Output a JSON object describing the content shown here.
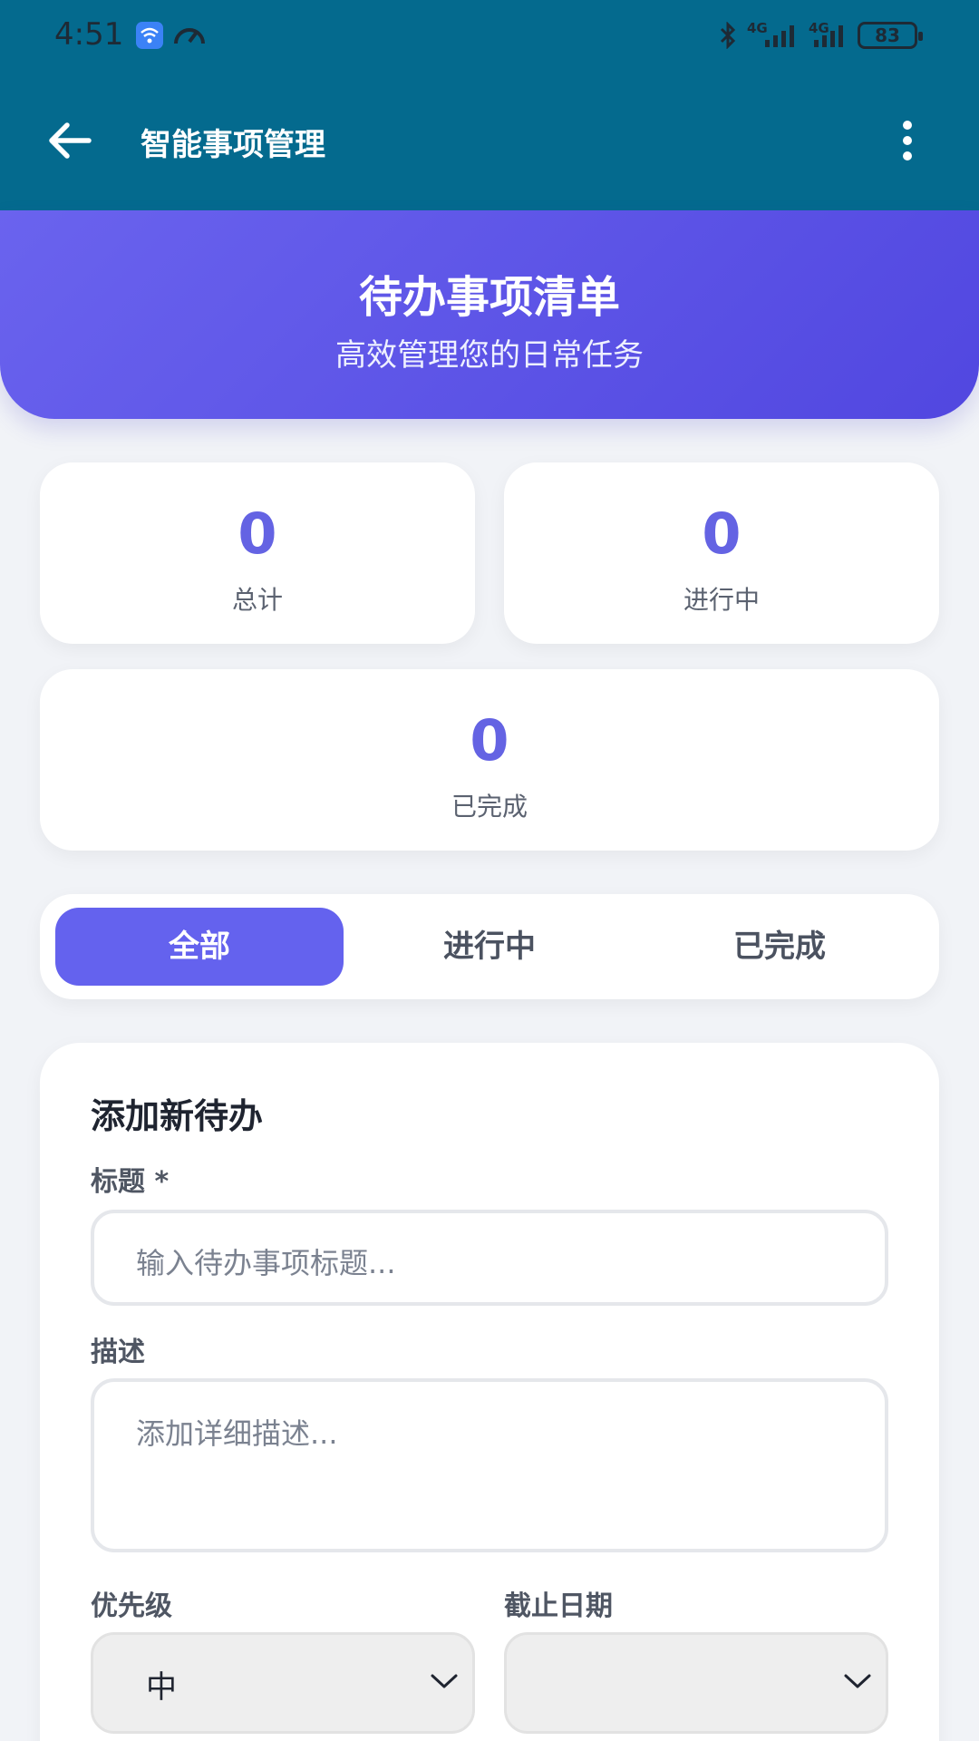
{
  "status_bar": {
    "time": "4:51",
    "battery": "83",
    "network_1": "4G",
    "network_2": "4G"
  },
  "app_bar": {
    "title": "智能事项管理"
  },
  "hero": {
    "title": "待办事项清单",
    "subtitle": "高效管理您的日常任务"
  },
  "stats": [
    {
      "value": "0",
      "label": "总计"
    },
    {
      "value": "0",
      "label": "进行中"
    },
    {
      "value": "0",
      "label": "已完成"
    }
  ],
  "filter_tabs": [
    {
      "label": "全部",
      "active": true
    },
    {
      "label": "进行中",
      "active": false
    },
    {
      "label": "已完成",
      "active": false
    }
  ],
  "form": {
    "title": "添加新待办",
    "title_label": "标题 *",
    "title_placeholder": "输入待办事项标题...",
    "description_label": "描述",
    "description_placeholder": "添加详细描述...",
    "priority_label": "优先级",
    "priority_value": "中",
    "deadline_label": "截止日期",
    "deadline_value": ""
  },
  "colors": {
    "appbar": "#046a8e",
    "accent": "#6462ee",
    "stat_value": "#6463e3"
  }
}
